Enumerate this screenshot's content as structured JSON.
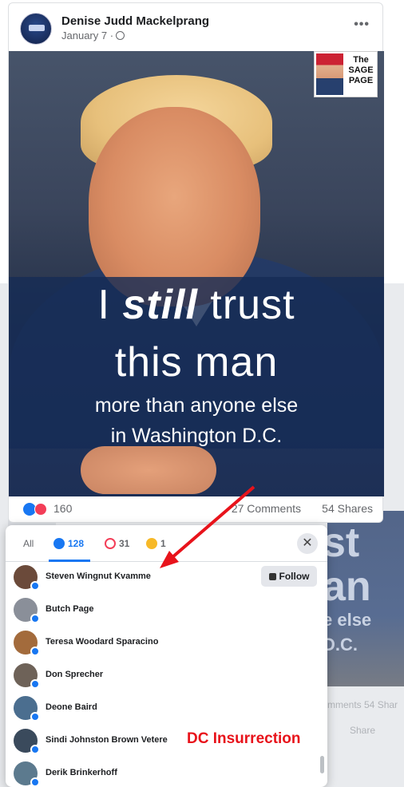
{
  "post": {
    "author": "Denise Judd Mackelprang",
    "date": "January 7 ·",
    "menu_glyph": "•••",
    "image_caption": {
      "line1_a": "I ",
      "line1_b": "still",
      "line1_c": " trust",
      "line2": "this man",
      "line3": "more than anyone else",
      "line4": "in Washington D.C."
    },
    "watermark_text": "The SAGE PAGE",
    "reactions_count": "160",
    "comments": "27 Comments",
    "shares": "54 Shares"
  },
  "background_ghost": {
    "big_text": "st",
    "an_text": "an",
    "else_text": "e else",
    "dc_text": "D.C.",
    "stats_text": "mments 54 Shar",
    "share_text": "Share"
  },
  "modal": {
    "tabs": {
      "all": "All",
      "like_count": "128",
      "love_count": "31",
      "haha_count": "1"
    },
    "close_glyph": "✕",
    "follow_label": "Follow",
    "people": [
      {
        "name": "Steven Wingnut Kvamme",
        "avatar_color": "#6b4a3a",
        "follow": true
      },
      {
        "name": "Butch Page",
        "avatar_color": "#8a8f99",
        "follow": false
      },
      {
        "name": "Teresa Woodard Sparacino",
        "avatar_color": "#a36b3c",
        "follow": false
      },
      {
        "name": "Don Sprecher",
        "avatar_color": "#6e6258",
        "follow": false
      },
      {
        "name": "Deone Baird",
        "avatar_color": "#4b6e8f",
        "follow": false
      },
      {
        "name": "Sindi Johnston Brown Vetere",
        "avatar_color": "#3a4a5c",
        "follow": false
      },
      {
        "name": "Derik Brinkerhoff",
        "avatar_color": "#5c7a8e",
        "follow": false
      }
    ]
  },
  "annotation": {
    "label": "DC Insurrection",
    "color": "#e8131b"
  }
}
